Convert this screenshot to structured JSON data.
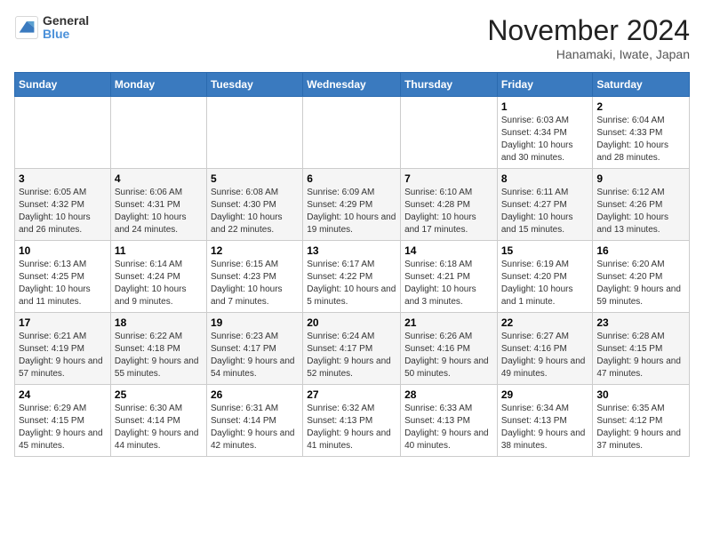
{
  "header": {
    "logo": {
      "line1": "General",
      "line2": "Blue"
    },
    "title": "November 2024",
    "subtitle": "Hanamaki, Iwate, Japan"
  },
  "weekdays": [
    "Sunday",
    "Monday",
    "Tuesday",
    "Wednesday",
    "Thursday",
    "Friday",
    "Saturday"
  ],
  "weeks": [
    [
      null,
      null,
      null,
      null,
      null,
      {
        "day": 1,
        "sunrise": "6:03 AM",
        "sunset": "4:34 PM",
        "daylight": "10 hours and 30 minutes."
      },
      {
        "day": 2,
        "sunrise": "6:04 AM",
        "sunset": "4:33 PM",
        "daylight": "10 hours and 28 minutes."
      }
    ],
    [
      {
        "day": 3,
        "sunrise": "6:05 AM",
        "sunset": "4:32 PM",
        "daylight": "10 hours and 26 minutes."
      },
      {
        "day": 4,
        "sunrise": "6:06 AM",
        "sunset": "4:31 PM",
        "daylight": "10 hours and 24 minutes."
      },
      {
        "day": 5,
        "sunrise": "6:08 AM",
        "sunset": "4:30 PM",
        "daylight": "10 hours and 22 minutes."
      },
      {
        "day": 6,
        "sunrise": "6:09 AM",
        "sunset": "4:29 PM",
        "daylight": "10 hours and 19 minutes."
      },
      {
        "day": 7,
        "sunrise": "6:10 AM",
        "sunset": "4:28 PM",
        "daylight": "10 hours and 17 minutes."
      },
      {
        "day": 8,
        "sunrise": "6:11 AM",
        "sunset": "4:27 PM",
        "daylight": "10 hours and 15 minutes."
      },
      {
        "day": 9,
        "sunrise": "6:12 AM",
        "sunset": "4:26 PM",
        "daylight": "10 hours and 13 minutes."
      }
    ],
    [
      {
        "day": 10,
        "sunrise": "6:13 AM",
        "sunset": "4:25 PM",
        "daylight": "10 hours and 11 minutes."
      },
      {
        "day": 11,
        "sunrise": "6:14 AM",
        "sunset": "4:24 PM",
        "daylight": "10 hours and 9 minutes."
      },
      {
        "day": 12,
        "sunrise": "6:15 AM",
        "sunset": "4:23 PM",
        "daylight": "10 hours and 7 minutes."
      },
      {
        "day": 13,
        "sunrise": "6:17 AM",
        "sunset": "4:22 PM",
        "daylight": "10 hours and 5 minutes."
      },
      {
        "day": 14,
        "sunrise": "6:18 AM",
        "sunset": "4:21 PM",
        "daylight": "10 hours and 3 minutes."
      },
      {
        "day": 15,
        "sunrise": "6:19 AM",
        "sunset": "4:20 PM",
        "daylight": "10 hours and 1 minute."
      },
      {
        "day": 16,
        "sunrise": "6:20 AM",
        "sunset": "4:20 PM",
        "daylight": "9 hours and 59 minutes."
      }
    ],
    [
      {
        "day": 17,
        "sunrise": "6:21 AM",
        "sunset": "4:19 PM",
        "daylight": "9 hours and 57 minutes."
      },
      {
        "day": 18,
        "sunrise": "6:22 AM",
        "sunset": "4:18 PM",
        "daylight": "9 hours and 55 minutes."
      },
      {
        "day": 19,
        "sunrise": "6:23 AM",
        "sunset": "4:17 PM",
        "daylight": "9 hours and 54 minutes."
      },
      {
        "day": 20,
        "sunrise": "6:24 AM",
        "sunset": "4:17 PM",
        "daylight": "9 hours and 52 minutes."
      },
      {
        "day": 21,
        "sunrise": "6:26 AM",
        "sunset": "4:16 PM",
        "daylight": "9 hours and 50 minutes."
      },
      {
        "day": 22,
        "sunrise": "6:27 AM",
        "sunset": "4:16 PM",
        "daylight": "9 hours and 49 minutes."
      },
      {
        "day": 23,
        "sunrise": "6:28 AM",
        "sunset": "4:15 PM",
        "daylight": "9 hours and 47 minutes."
      }
    ],
    [
      {
        "day": 24,
        "sunrise": "6:29 AM",
        "sunset": "4:15 PM",
        "daylight": "9 hours and 45 minutes."
      },
      {
        "day": 25,
        "sunrise": "6:30 AM",
        "sunset": "4:14 PM",
        "daylight": "9 hours and 44 minutes."
      },
      {
        "day": 26,
        "sunrise": "6:31 AM",
        "sunset": "4:14 PM",
        "daylight": "9 hours and 42 minutes."
      },
      {
        "day": 27,
        "sunrise": "6:32 AM",
        "sunset": "4:13 PM",
        "daylight": "9 hours and 41 minutes."
      },
      {
        "day": 28,
        "sunrise": "6:33 AM",
        "sunset": "4:13 PM",
        "daylight": "9 hours and 40 minutes."
      },
      {
        "day": 29,
        "sunrise": "6:34 AM",
        "sunset": "4:13 PM",
        "daylight": "9 hours and 38 minutes."
      },
      {
        "day": 30,
        "sunrise": "6:35 AM",
        "sunset": "4:12 PM",
        "daylight": "9 hours and 37 minutes."
      }
    ]
  ]
}
